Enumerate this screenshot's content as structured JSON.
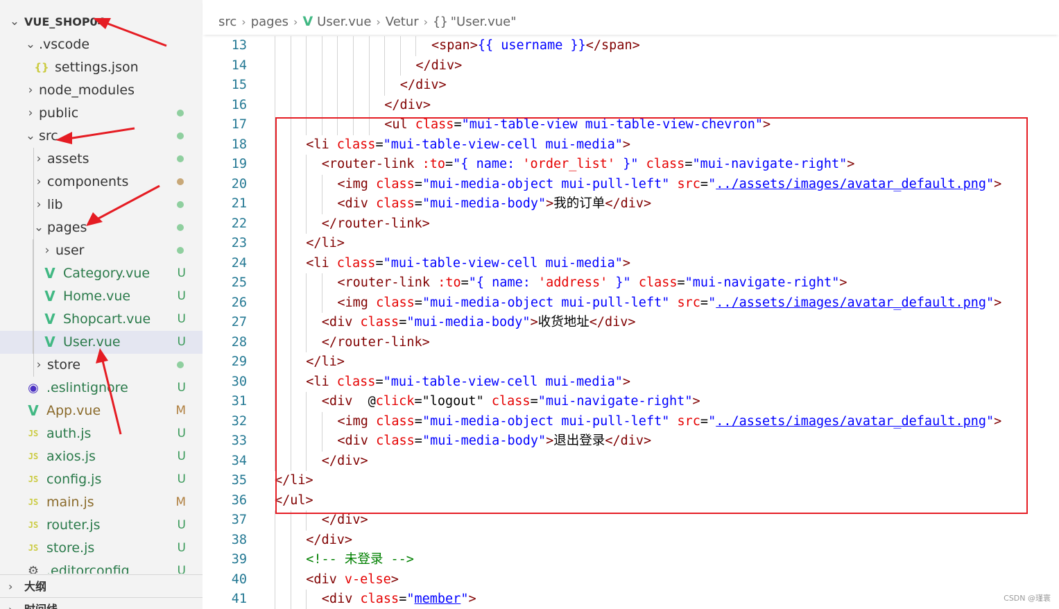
{
  "explorer": {
    "root_label": "VUE_SHOP04",
    "items": [
      {
        "label": ".vscode",
        "kind": "folder",
        "expanded": true,
        "depth": 1,
        "badge": ""
      },
      {
        "label": "settings.json",
        "kind": "json",
        "depth": 2,
        "badge": "",
        "icon": "{}"
      },
      {
        "label": "node_modules",
        "kind": "folder",
        "expanded": false,
        "depth": 1,
        "badge": ""
      },
      {
        "label": "public",
        "kind": "folder",
        "expanded": false,
        "depth": 1,
        "badge": "dot"
      },
      {
        "label": "src",
        "kind": "folder",
        "expanded": true,
        "depth": 1,
        "badge": "dot"
      },
      {
        "label": "assets",
        "kind": "folder",
        "expanded": false,
        "depth": 2,
        "badge": "dot"
      },
      {
        "label": "components",
        "kind": "folder",
        "expanded": false,
        "depth": 2,
        "badge": "dot-brown"
      },
      {
        "label": "lib",
        "kind": "folder",
        "expanded": false,
        "depth": 2,
        "badge": "dot"
      },
      {
        "label": "pages",
        "kind": "folder",
        "expanded": true,
        "depth": 2,
        "badge": "dot"
      },
      {
        "label": "user",
        "kind": "folder",
        "expanded": false,
        "depth": 3,
        "badge": "dot"
      },
      {
        "label": "Category.vue",
        "kind": "vue",
        "depth": 3,
        "badge": "U"
      },
      {
        "label": "Home.vue",
        "kind": "vue",
        "depth": 3,
        "badge": "U"
      },
      {
        "label": "Shopcart.vue",
        "kind": "vue",
        "depth": 3,
        "badge": "U"
      },
      {
        "label": "User.vue",
        "kind": "vue",
        "depth": 3,
        "badge": "U",
        "selected": true
      },
      {
        "label": "store",
        "kind": "folder",
        "expanded": false,
        "depth": 2,
        "badge": "dot"
      },
      {
        "label": ".eslintignore",
        "kind": "eslint",
        "depth": 1,
        "badge": "U"
      },
      {
        "label": "App.vue",
        "kind": "vue",
        "depth": 1,
        "badge": "M"
      },
      {
        "label": "auth.js",
        "kind": "js",
        "depth": 1,
        "badge": "U",
        "icon": "JS"
      },
      {
        "label": "axios.js",
        "kind": "js",
        "depth": 1,
        "badge": "U",
        "icon": "JS"
      },
      {
        "label": "config.js",
        "kind": "js",
        "depth": 1,
        "badge": "U",
        "icon": "JS"
      },
      {
        "label": "main.js",
        "kind": "js",
        "depth": 1,
        "badge": "M",
        "icon": "JS"
      },
      {
        "label": "router.js",
        "kind": "js",
        "depth": 1,
        "badge": "U",
        "icon": "JS"
      },
      {
        "label": "store.js",
        "kind": "js",
        "depth": 1,
        "badge": "U",
        "icon": "JS"
      },
      {
        "label": ".editorconfig",
        "kind": "gear",
        "depth": 1,
        "badge": "U"
      }
    ],
    "outline_label": "大纲",
    "timeline_label": "时间线"
  },
  "breadcrumb": {
    "items": [
      "src",
      "pages",
      "User.vue",
      "Vetur",
      "\"User.vue\""
    ],
    "brace_icon": "{}"
  },
  "colors": {
    "git_untracked": "#73c991",
    "git_modified": "#d0a35c",
    "highlight_box": "#e51c23",
    "arrow": "#e51c23"
  },
  "code_lines": [
    {
      "n": "13",
      "indent": 10,
      "tokens": [
        [
          "tag",
          "<span>"
        ],
        [
          "str",
          "{{ username }}"
        ],
        [
          "tag",
          "</span>"
        ]
      ]
    },
    {
      "n": "14",
      "indent": 9,
      "tokens": [
        [
          "tag",
          "</div>"
        ]
      ]
    },
    {
      "n": "15",
      "indent": 8,
      "tokens": [
        [
          "tag",
          "</div>"
        ]
      ]
    },
    {
      "n": "16",
      "indent": 7,
      "tokens": [
        [
          "tag",
          "</div>"
        ]
      ]
    },
    {
      "n": "17",
      "indent": 7,
      "tokens": [
        [
          "tag",
          "<ul "
        ],
        [
          "attr",
          "class"
        ],
        [
          "txt",
          "="
        ],
        [
          "str",
          "\"mui-table-view mui-table-view-chevron\""
        ],
        [
          "tag",
          ">"
        ]
      ]
    },
    {
      "n": "18",
      "indent": 2,
      "tokens": [
        [
          "tag",
          "<li "
        ],
        [
          "attr",
          "class"
        ],
        [
          "txt",
          "="
        ],
        [
          "str",
          "\"mui-table-view-cell mui-media\""
        ],
        [
          "tag",
          ">"
        ]
      ]
    },
    {
      "n": "19",
      "indent": 3,
      "tokens": [
        [
          "tag",
          "<router-link "
        ],
        [
          "attr",
          ":to"
        ],
        [
          "txt",
          "="
        ],
        [
          "str",
          "\"{ name: "
        ],
        [
          "attr",
          "'order_list'"
        ],
        [
          "str",
          " }\" "
        ],
        [
          "attr",
          "class"
        ],
        [
          "txt",
          "="
        ],
        [
          "str",
          "\"mui-navigate-right\""
        ],
        [
          "tag",
          ">"
        ]
      ]
    },
    {
      "n": "20",
      "indent": 4,
      "tokens": [
        [
          "tag",
          "<img "
        ],
        [
          "attr",
          "class"
        ],
        [
          "txt",
          "="
        ],
        [
          "str",
          "\"mui-media-object mui-pull-left\" "
        ],
        [
          "attr",
          "src"
        ],
        [
          "txt",
          "="
        ],
        [
          "str",
          "\""
        ],
        [
          "link",
          "../assets/images/avatar_default.png"
        ],
        [
          "str",
          "\""
        ],
        [
          "tag",
          ">"
        ]
      ]
    },
    {
      "n": "21",
      "indent": 4,
      "tokens": [
        [
          "tag",
          "<div "
        ],
        [
          "attr",
          "class"
        ],
        [
          "txt",
          "="
        ],
        [
          "str",
          "\"mui-media-body\""
        ],
        [
          "tag",
          ">"
        ],
        [
          "txt",
          "我的订单"
        ],
        [
          "tag",
          "</div>"
        ]
      ]
    },
    {
      "n": "22",
      "indent": 3,
      "tokens": [
        [
          "tag",
          "</router-link>"
        ]
      ]
    },
    {
      "n": "23",
      "indent": 2,
      "tokens": [
        [
          "tag",
          "</li>"
        ]
      ]
    },
    {
      "n": "24",
      "indent": 2,
      "tokens": [
        [
          "tag",
          "<li "
        ],
        [
          "attr",
          "class"
        ],
        [
          "txt",
          "="
        ],
        [
          "str",
          "\"mui-table-view-cell mui-media\""
        ],
        [
          "tag",
          ">"
        ]
      ]
    },
    {
      "n": "25",
      "indent": 4,
      "tokens": [
        [
          "tag",
          "<router-link "
        ],
        [
          "attr",
          ":to"
        ],
        [
          "txt",
          "="
        ],
        [
          "str",
          "\"{ name: "
        ],
        [
          "attr",
          "'address'"
        ],
        [
          "str",
          " }\" "
        ],
        [
          "attr",
          "class"
        ],
        [
          "txt",
          "="
        ],
        [
          "str",
          "\"mui-navigate-right\""
        ],
        [
          "tag",
          ">"
        ]
      ]
    },
    {
      "n": "26",
      "indent": 4,
      "tokens": [
        [
          "tag",
          "<img "
        ],
        [
          "attr",
          "class"
        ],
        [
          "txt",
          "="
        ],
        [
          "str",
          "\"mui-media-object mui-pull-left\" "
        ],
        [
          "attr",
          "src"
        ],
        [
          "txt",
          "="
        ],
        [
          "str",
          "\""
        ],
        [
          "link",
          "../assets/images/avatar_default.png"
        ],
        [
          "str",
          "\""
        ],
        [
          "tag",
          ">"
        ]
      ]
    },
    {
      "n": "27",
      "indent": 3,
      "tokens": [
        [
          "tag",
          "<div "
        ],
        [
          "attr",
          "class"
        ],
        [
          "txt",
          "="
        ],
        [
          "str",
          "\"mui-media-body\""
        ],
        [
          "tag",
          ">"
        ],
        [
          "txt",
          "收货地址"
        ],
        [
          "tag",
          "</div>"
        ]
      ]
    },
    {
      "n": "28",
      "indent": 3,
      "tokens": [
        [
          "tag",
          "</router-link>"
        ]
      ]
    },
    {
      "n": "29",
      "indent": 2,
      "tokens": [
        [
          "tag",
          "</li>"
        ]
      ]
    },
    {
      "n": "30",
      "indent": 2,
      "tokens": [
        [
          "tag",
          "<li "
        ],
        [
          "attr",
          "class"
        ],
        [
          "txt",
          "="
        ],
        [
          "str",
          "\"mui-table-view-cell mui-media\""
        ],
        [
          "tag",
          ">"
        ]
      ]
    },
    {
      "n": "31",
      "indent": 3,
      "tokens": [
        [
          "tag",
          "<div  "
        ],
        [
          "txt",
          "@"
        ],
        [
          "attr",
          "click"
        ],
        [
          "txt",
          "="
        ],
        [
          "txt",
          "\"logout\" "
        ],
        [
          "attr",
          "class"
        ],
        [
          "txt",
          "="
        ],
        [
          "str",
          "\"mui-navigate-right\""
        ],
        [
          "tag",
          ">"
        ]
      ]
    },
    {
      "n": "32",
      "indent": 4,
      "tokens": [
        [
          "tag",
          "<img "
        ],
        [
          "attr",
          "class"
        ],
        [
          "txt",
          "="
        ],
        [
          "str",
          "\"mui-media-object mui-pull-left\" "
        ],
        [
          "attr",
          "src"
        ],
        [
          "txt",
          "="
        ],
        [
          "str",
          "\""
        ],
        [
          "link",
          "../assets/images/avatar_default.png"
        ],
        [
          "str",
          "\""
        ],
        [
          "tag",
          ">"
        ]
      ]
    },
    {
      "n": "33",
      "indent": 4,
      "tokens": [
        [
          "tag",
          "<div "
        ],
        [
          "attr",
          "class"
        ],
        [
          "txt",
          "="
        ],
        [
          "str",
          "\"mui-media-body\""
        ],
        [
          "tag",
          ">"
        ],
        [
          "txt",
          "退出登录"
        ],
        [
          "tag",
          "</div>"
        ]
      ]
    },
    {
      "n": "34",
      "indent": 3,
      "tokens": [
        [
          "tag",
          "</div>"
        ]
      ]
    },
    {
      "n": "35",
      "indent": 0,
      "tokens": [
        [
          "tag",
          "</li>"
        ]
      ]
    },
    {
      "n": "36",
      "indent": 0,
      "tokens": [
        [
          "tag",
          "</ul>"
        ]
      ]
    },
    {
      "n": "37",
      "indent": 3,
      "tokens": [
        [
          "tag",
          "</div>"
        ]
      ]
    },
    {
      "n": "38",
      "indent": 2,
      "tokens": [
        [
          "tag",
          "</div>"
        ]
      ]
    },
    {
      "n": "39",
      "indent": 2,
      "tokens": [
        [
          "cmt",
          "<!-- 未登录 -->"
        ]
      ]
    },
    {
      "n": "40",
      "indent": 2,
      "tokens": [
        [
          "tag",
          "<div "
        ],
        [
          "attr",
          "v-else"
        ],
        [
          "tag",
          ">"
        ]
      ]
    },
    {
      "n": "41",
      "indent": 3,
      "tokens": [
        [
          "tag",
          "<div "
        ],
        [
          "attr",
          "class"
        ],
        [
          "txt",
          "="
        ],
        [
          "str",
          "\""
        ],
        [
          "link",
          "member"
        ],
        [
          "str",
          "\""
        ],
        [
          "tag",
          ">"
        ]
      ]
    }
  ],
  "watermark": "CSDN @瑾寰"
}
